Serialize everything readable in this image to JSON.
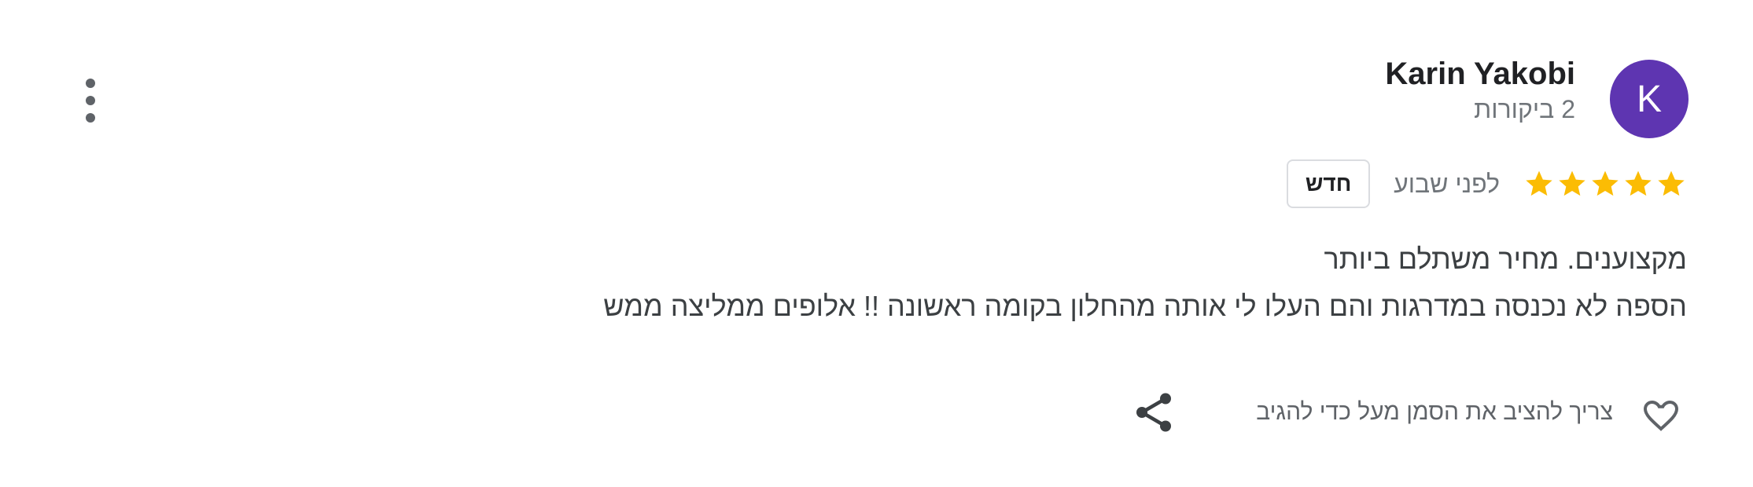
{
  "reviewer": {
    "name": "Karin Yakobi",
    "review_count": "2 ביקורות",
    "avatar_letter": "K",
    "avatar_color": "#5e35b1"
  },
  "review": {
    "rating": 5,
    "rating_max": 5,
    "star_color": "#fbbc04",
    "time": "לפני שבוע",
    "badge": "חדש",
    "text_lines": [
      "מקצוענים. מחיר משתלם ביותר",
      "הספה לא נכנסה במדרגות והם העלו לי אותה מהחלון בקומה ראשונה !! אלופים ממליצה ממש"
    ]
  },
  "actions": {
    "like_icon": "heart-icon",
    "like_label": "צריך להציב את הסמן מעל כדי להגיב",
    "share_icon": "share-icon",
    "menu_icon": "more-vert-icon"
  }
}
